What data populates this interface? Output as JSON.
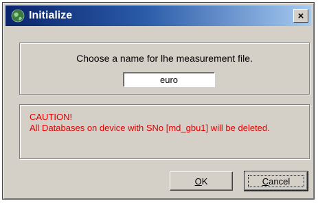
{
  "window": {
    "title": "Initialize",
    "close_glyph": "×",
    "icon": "globe-icon"
  },
  "prompt": {
    "label": "Choose a name for lhe measurement file.",
    "value": "euro"
  },
  "caution": {
    "line1": "CAUTION!",
    "line2": "All Databases on device with SNo [md_gbu1] will be deleted."
  },
  "buttons": {
    "ok_mnemonic": "O",
    "ok_rest": "K",
    "cancel_mnemonic": "C",
    "cancel_rest": "ancel"
  },
  "colors": {
    "caution_text": "#e00000",
    "titlebar_start": "#0a246a",
    "titlebar_end": "#a6caf0"
  }
}
